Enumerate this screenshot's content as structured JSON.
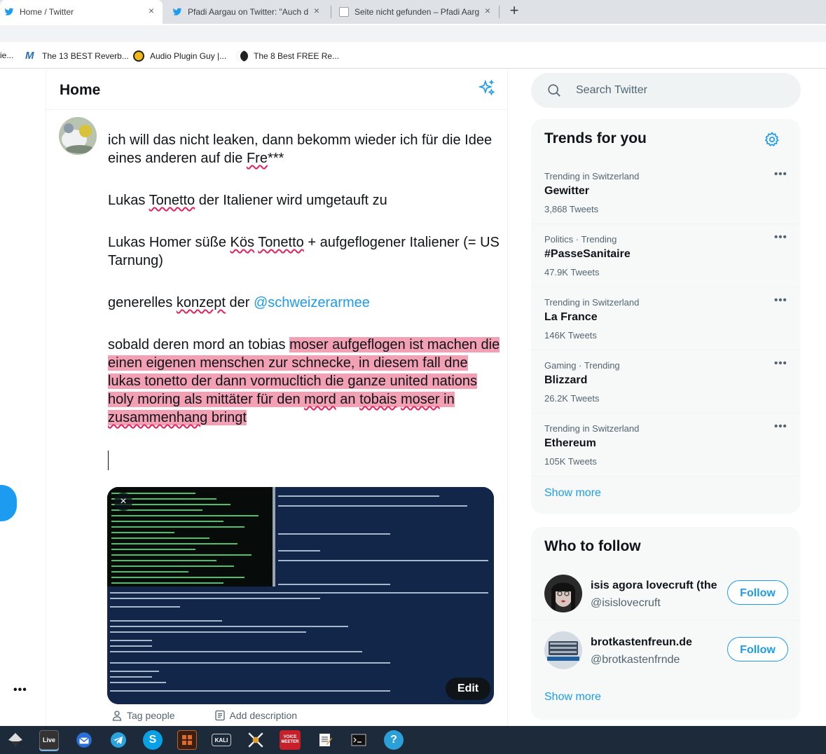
{
  "browser": {
    "tabs": [
      {
        "title": "Home / Twitter",
        "active": true
      },
      {
        "title": "Pfadi Aargau on Twitter: \"Auch d",
        "active": false
      },
      {
        "title": "Seite nicht gefunden – Pfadi Aarg",
        "active": false
      }
    ],
    "tab_close": "×",
    "new_tab": "+",
    "bookmarks": [
      {
        "label": "ie..."
      },
      {
        "label": "The 13 BEST Reverb..."
      },
      {
        "label": "Audio Plugin Guy |..."
      },
      {
        "label": "The 8 Best FREE Re..."
      }
    ]
  },
  "main": {
    "header_title": "Home",
    "compose": {
      "line1a": "ich will das nicht leaken, dann bekomm wieder ich für die Idee eines anderen auf die ",
      "line1b": "Fre",
      "line1c": "***",
      "line2a": "Lukas ",
      "line2b": "Tonetto",
      "line2c": " der Italiener wird umgetauft zu",
      "line3a": "Lukas Homer süße ",
      "line3b": "Kös",
      "line3c": " ",
      "line3d": "Tonetto",
      "line3e": " + aufgeflogener Italiener (= US Tarnung)",
      "line4a": "generelles ",
      "line4b": "konzept",
      "line4c": " der ",
      "line4mention": "@schweizerarmee",
      "line5a": "sobald deren mord an tobias ",
      "line5hl1": "moser aufgeflogen ist machen die einen eigenen menschen zur schnecke, in diesem fall dne lukas tonetto der dann vormucltich die ganze united nations holy moring als mittäter für den ",
      "line5hl2": "mord",
      "line5hl3": " an ",
      "line5hl4": "tobais",
      "line5hl5": " ",
      "line5hl6": "moser",
      "line5hl7": " in ",
      "line5hl8": "zusammenhang",
      "line5hl9": " bringt"
    },
    "media": {
      "close": "×",
      "edit_label": "Edit"
    },
    "media_tools": {
      "tag_people": "Tag people",
      "add_description": "Add description"
    },
    "more_dots": "•••"
  },
  "sidebar": {
    "search_placeholder": "Search Twitter",
    "trends_title": "Trends for you",
    "trends": [
      {
        "context": "Trending in Switzerland",
        "name": "Gewitter",
        "count": "3,868 Tweets"
      },
      {
        "context": "Politics · Trending",
        "name": "#PasseSanitaire",
        "count": "47.9K Tweets"
      },
      {
        "context": "Trending in Switzerland",
        "name": "La France",
        "count": "146K Tweets"
      },
      {
        "context": "Gaming · Trending",
        "name": "Blizzard",
        "count": "26.2K Tweets"
      },
      {
        "context": "Trending in Switzerland",
        "name": "Ethereum",
        "count": "105K Tweets"
      }
    ],
    "trend_more": "•••",
    "show_more": "Show more",
    "who_to_follow_title": "Who to follow",
    "follow_suggestions": [
      {
        "name": "isis agora lovecruft (the",
        "handle": "@isislovecruft",
        "button": "Follow"
      },
      {
        "name": "brotkastenfreun.de",
        "handle": "@brotkastenfrnde",
        "button": "Follow"
      }
    ]
  },
  "taskbar": {
    "apps": [
      {
        "icon": "inkscape-icon",
        "label": ""
      },
      {
        "icon": "live-icon",
        "label": "Live"
      },
      {
        "icon": "thunderbird-icon",
        "label": ""
      },
      {
        "icon": "telegram-icon",
        "label": ""
      },
      {
        "icon": "skype-icon",
        "label": "S"
      },
      {
        "icon": "calculator-icon",
        "label": ""
      },
      {
        "icon": "kali-icon",
        "label": "KALI"
      },
      {
        "icon": "x-tool-icon",
        "label": ""
      },
      {
        "icon": "voicemeeter-icon",
        "label": "VOICE MEETER"
      },
      {
        "icon": "notepad-icon",
        "label": ""
      },
      {
        "icon": "terminal-icon",
        "label": ""
      },
      {
        "icon": "help-icon",
        "label": "?"
      }
    ]
  },
  "colors": {
    "accent": "#1d9bf0",
    "highlight": "#f4a0b4",
    "taskbar": "#1c2a3a"
  }
}
